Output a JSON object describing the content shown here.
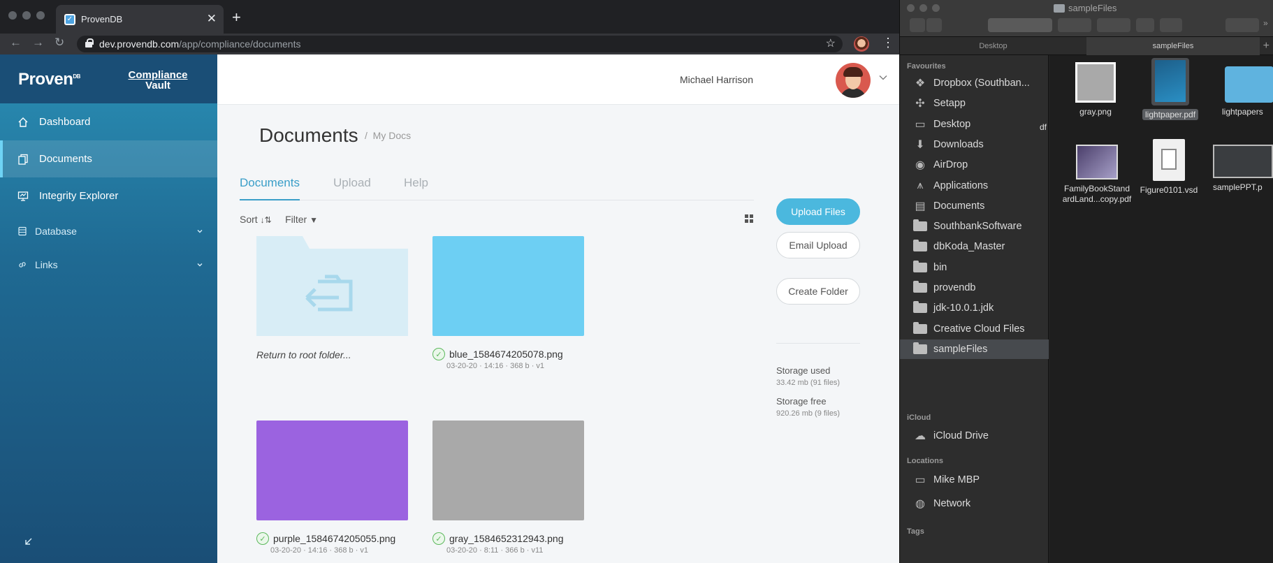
{
  "browser": {
    "tab_title": "ProvenDB",
    "url_host": "dev.provendb.com",
    "url_path": "/app/compliance/documents"
  },
  "app": {
    "logo": "Proven",
    "logo_sup": "DB",
    "vault_line1": "Compliance",
    "vault_line2": "Vault",
    "nav": [
      {
        "label": "Dashboard",
        "icon": "home-icon"
      },
      {
        "label": "Documents",
        "icon": "documents-icon"
      },
      {
        "label": "Integrity Explorer",
        "icon": "monitor-icon"
      },
      {
        "label": "Database",
        "icon": "database-icon"
      },
      {
        "label": "Links",
        "icon": "link-icon"
      }
    ],
    "user_name": "Michael Harrison",
    "page_title": "Documents",
    "breadcrumb_sep": "/",
    "breadcrumb": "My Docs",
    "tabs": [
      "Documents",
      "Upload",
      "Help"
    ],
    "sort_label": "Sort",
    "filter_label": "Filter",
    "folder_caption": "Return to root folder...",
    "files": [
      {
        "name": "blue_1584674205078.png",
        "meta": "03-20-20 · 14:16 · 368 b · v1",
        "color": "#6dcff3"
      },
      {
        "name": "purple_1584674205055.png",
        "meta": "03-20-20 · 14:16 · 368 b · v1",
        "color": "#9b63e0"
      },
      {
        "name": "gray_1584652312943.png",
        "meta": "03-20-20 · 8:11 · 366 b · v11",
        "color": "#a9a9a9"
      }
    ],
    "buttons": {
      "upload": "Upload Files",
      "email": "Email Upload",
      "create_folder": "Create Folder"
    },
    "storage": {
      "used_label": "Storage used",
      "used_value": "33.42 mb (91 files)",
      "free_label": "Storage free",
      "free_value": "920.26 mb (9 files)"
    }
  },
  "finder": {
    "title": "sampleFiles",
    "tabs": [
      "Desktop",
      "sampleFiles"
    ],
    "sections": {
      "favourites": "Favourites",
      "icloud": "iCloud",
      "locations": "Locations",
      "tags": "Tags"
    },
    "favourites": [
      {
        "label": "Dropbox (Southban...",
        "icon": "dropbox-icon"
      },
      {
        "label": "Setapp",
        "icon": "setapp-icon"
      },
      {
        "label": "Desktop",
        "icon": "desktop-icon"
      },
      {
        "label": "Downloads",
        "icon": "downloads-icon"
      },
      {
        "label": "AirDrop",
        "icon": "airdrop-icon"
      },
      {
        "label": "Applications",
        "icon": "applications-icon"
      },
      {
        "label": "Documents",
        "icon": "document-icon"
      },
      {
        "label": "SouthbankSoftware",
        "icon": "folder-icon"
      },
      {
        "label": "dbKoda_Master",
        "icon": "folder-icon"
      },
      {
        "label": "bin",
        "icon": "folder-icon"
      },
      {
        "label": "provendb",
        "icon": "folder-icon"
      },
      {
        "label": "jdk-10.0.1.jdk",
        "icon": "folder-icon"
      },
      {
        "label": "Creative Cloud Files",
        "icon": "folder-icon"
      },
      {
        "label": "sampleFiles",
        "icon": "folder-icon"
      }
    ],
    "icloud_items": [
      {
        "label": "iCloud Drive",
        "icon": "cloud-icon"
      }
    ],
    "locations": [
      {
        "label": "Mike MBP",
        "icon": "laptop-icon"
      },
      {
        "label": "Network",
        "icon": "network-icon"
      }
    ],
    "files": [
      {
        "line1": "df",
        "line2": ""
      },
      {
        "line1": "gray.png",
        "line2": ""
      },
      {
        "line1": "lightpaper.pdf",
        "line2": ""
      },
      {
        "line1": "lightpapers",
        "line2": ""
      },
      {
        "line1": "FamilyBookStand",
        "line2": "ardLand...copy.pdf"
      },
      {
        "line1": "Figure0101.vsd",
        "line2": ""
      },
      {
        "line1": "samplePPT.p",
        "line2": ""
      }
    ]
  }
}
